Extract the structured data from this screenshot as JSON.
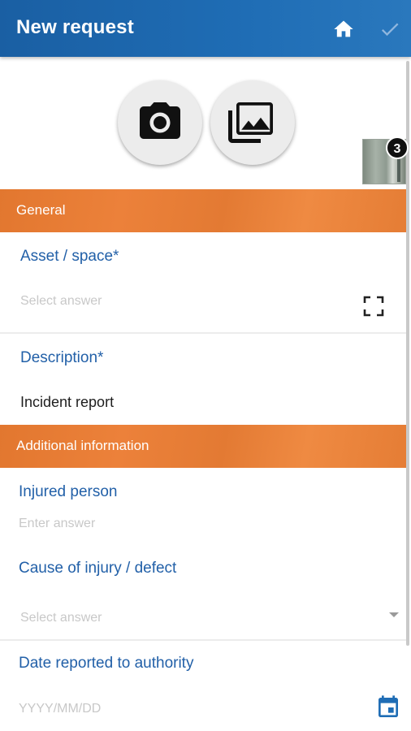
{
  "appbar": {
    "title": "New request",
    "home_icon": "home-icon",
    "confirm_icon": "check-icon"
  },
  "media": {
    "camera_icon": "camera-icon",
    "gallery_icon": "gallery-icon",
    "attachment_count": "3"
  },
  "sections": {
    "general": "General",
    "additional": "Additional information"
  },
  "fields": {
    "asset": {
      "label": "Asset / space*",
      "placeholder": "Select answer"
    },
    "description": {
      "label": "Description*",
      "value": "Incident report"
    },
    "injured": {
      "label": "Injured person",
      "placeholder": "Enter answer"
    },
    "cause": {
      "label": "Cause of injury / defect",
      "placeholder": "Select answer"
    },
    "date": {
      "label": "Date reported to authority",
      "placeholder": "YYYY/MM/DD"
    }
  },
  "colors": {
    "primary": "#1f6db5",
    "accent": "#ec813a",
    "label": "#2260a8"
  }
}
